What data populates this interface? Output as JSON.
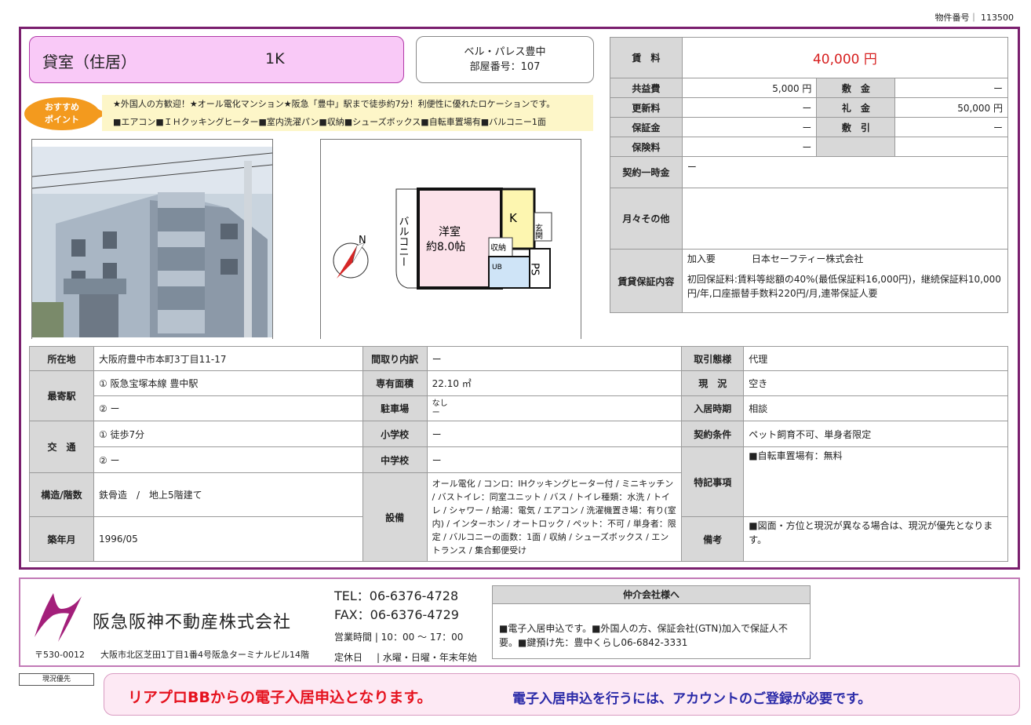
{
  "property_number_label": "物件番号",
  "property_number": "113500",
  "listing_type": "貸室（住居）",
  "layout": "1K",
  "building_name": "ベル・パレス豊中",
  "room_number": "部屋番号：107",
  "recommend_badge": "おすすめ\nポイント",
  "recommend_line1": "★外国人の方歓迎！★オール電化マンション★阪急「豊中」駅まで徒歩約7分！利便性に優れたロケーションです。",
  "recommend_line2": "■エアコン■ＩＨクッキングヒーター■室内洗濯パン■収納■シューズボックス■自転車置場有■バルコニー1面",
  "floorplan": {
    "room_label": "洋室",
    "room_size": "約8.0帖",
    "kitchen": "K",
    "entrance": "玄関",
    "storage": "収納",
    "balcony": "バルコニー",
    "bath": "UB",
    "ps": "PS",
    "north": "N"
  },
  "fees": {
    "rent_label": "賃　料",
    "rent": "40,000 円",
    "common_label": "共益費",
    "common": "5,000 円",
    "deposit_label": "敷　金",
    "deposit": "ー",
    "renewal_label": "更新料",
    "renewal": "ー",
    "key_money_label": "礼　金",
    "key_money": "50,000 円",
    "guarantee_label": "保証金",
    "guarantee": "ー",
    "deduction_label": "敷　引",
    "deduction": "ー",
    "insurance_label": "保険料",
    "insurance": "ー",
    "contract_once_label": "契約一時金",
    "contract_once": "ー",
    "monthly_other_label": "月々その他",
    "guarantor_label": "賃貸保証内容",
    "guarantor_required": "加入要",
    "guarantor_company": "日本セーフティー株式会社",
    "guarantor_detail": "初回保証料:賃料等総額の40%(最低保証料16,000円)，継続保証料10,000円/年,口座振替手数料220円/月,連帯保証人要"
  },
  "details": {
    "address_label": "所在地",
    "address": "大阪府豊中市本町3丁目11-17",
    "station_label": "最寄駅",
    "station1": "① 阪急宝塚本線 豊中駅",
    "station2": "② ー",
    "access_label": "交　通",
    "access1": "① 徒歩7分",
    "access2": "② ー",
    "structure_label": "構造/階数",
    "structure": "鉄骨造　/　地上5階建て",
    "built_label": "築年月",
    "built": "1996/05",
    "room_layout_label": "間取り内訳",
    "room_layout": "ー",
    "area_label": "専有面積",
    "area": "22.10 ㎡",
    "parking_label": "駐車場",
    "parking1": "なし",
    "parking2": "ー",
    "elementary_label": "小学校",
    "elementary": "ー",
    "junior_label": "中学校",
    "junior": "ー",
    "equipment_label": "設備",
    "equipment": "オール電化 / コンロ：IHクッキングヒーター付 / ミニキッチン / バストイレ：同室ユニット / バス / トイレ種類：水洗 / トイレ / シャワー / 給湯：電気 / エアコン / 洗濯機置き場：有り(室内) / インターホン / オートロック / ペット：不可 / 単身者：限定 / バルコニーの面数：1面 / 収納 / シューズボックス / エントランス / 集合郵便受け",
    "deal_label": "取引態様",
    "deal": "代理",
    "status_label": "現　況",
    "status": "空き",
    "move_in_label": "入居時期",
    "move_in": "相談",
    "conditions_label": "契約条件",
    "conditions": "ペット飼育不可、単身者限定",
    "special_label": "特記事項",
    "special": "■自転車置場有：無料",
    "remarks_label": "備考",
    "remarks": "■図面・方位と現況が異なる場合は、現況が優先となります。"
  },
  "company": {
    "name": "阪急阪神不動産株式会社",
    "postal": "〒530-0012",
    "address": "大阪市北区芝田1丁目1番4号阪急ターミナルビル14階",
    "tel": "TEL：06-6376-4728",
    "fax": "FAX：06-6376-4729",
    "hours": "営業時間 | 10：00 ～ 17：00",
    "holiday_label": "定休日",
    "holiday": "| 水曜・日曜・年末年始"
  },
  "agent": {
    "title": "仲介会社様へ",
    "body": "■電子入居申込です。■外国人の方、保証会社(GTN)加入で保証人不要。■鍵預け先：豊中くらし06-6842-3331"
  },
  "genkyo": "現況優先",
  "banner_left": "リアプロBBからの電子入居申込となります。",
  "banner_right": "電子入居申込を行うには、アカウントのご登録が必要です。",
  "colors": {
    "frame": "#7a1f6e",
    "type_box": "#f9c9f7",
    "rent": "#d72020",
    "badge": "#f39a1e"
  }
}
